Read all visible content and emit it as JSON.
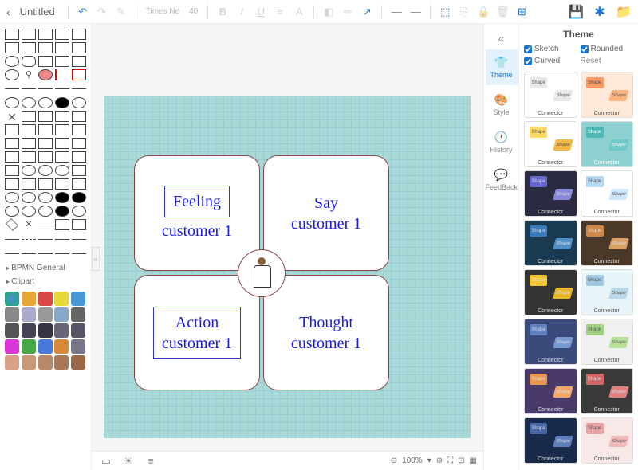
{
  "header": {
    "title": "Untitled",
    "font_name": "Times Ne",
    "font_size": "40"
  },
  "canvas": {
    "q1_line1": "Feeling",
    "q1_line2": "customer 1",
    "q2_line1": "Say",
    "q2_line2": "customer 1",
    "q3_line1": "Action",
    "q3_line2": "customer 1",
    "q4_line1": "Thought",
    "q4_line2": "customer 1"
  },
  "zoom": {
    "level": "100%"
  },
  "sidebar": {
    "cat_bpmn": "BPMN General",
    "cat_clipart": "Clipart"
  },
  "right_tabs": {
    "theme": "Theme",
    "style": "Style",
    "history": "History",
    "feedback": "FeedBack"
  },
  "theme": {
    "title": "Theme",
    "sketch": "Sketch",
    "curved": "Curved",
    "rounded": "Rounded",
    "reset": "Reset",
    "shape_label": "Shape",
    "connector_label": "Connector",
    "swatches": [
      {
        "bg": "#ffffff",
        "s1": "#e8e8e8",
        "s2": "#e8e8e8",
        "fg": "#555"
      },
      {
        "bg": "#ffe8d8",
        "s1": "#ff9966",
        "s2": "#ffb380",
        "fg": "#555"
      },
      {
        "bg": "#ffffff",
        "s1": "#ffd966",
        "s2": "#f4b942",
        "fg": "#555"
      },
      {
        "bg": "#8ecfcf",
        "s1": "#4db8b8",
        "s2": "#6ec9c9",
        "fg": "#fff"
      },
      {
        "bg": "#2a2a40",
        "s1": "#6666cc",
        "s2": "#8888dd",
        "fg": "#ddd"
      },
      {
        "bg": "#ffffff",
        "s1": "#b3d9f2",
        "s2": "#cce6ff",
        "fg": "#555"
      },
      {
        "bg": "#1a3a52",
        "s1": "#3a7ab8",
        "s2": "#5090c8",
        "fg": "#ddd"
      },
      {
        "bg": "#4a3828",
        "s1": "#cc8844",
        "s2": "#d9a066",
        "fg": "#ddd"
      },
      {
        "bg": "#333333",
        "s1": "#f4c430",
        "s2": "#e8b828",
        "fg": "#ddd"
      },
      {
        "bg": "#e8f4f8",
        "s1": "#a0c8e0",
        "s2": "#b8d8e8",
        "fg": "#555"
      },
      {
        "bg": "#3a4a7a",
        "s1": "#6080c0",
        "s2": "#7898d0",
        "fg": "#ddd"
      },
      {
        "bg": "#f0f0f0",
        "s1": "#a0d080",
        "s2": "#b8e098",
        "fg": "#555"
      },
      {
        "bg": "#4a3a6a",
        "s1": "#e89850",
        "s2": "#f0a868",
        "fg": "#ddd"
      },
      {
        "bg": "#3a3a3a",
        "s1": "#d06868",
        "s2": "#e08080",
        "fg": "#ddd"
      },
      {
        "bg": "#1a2a4a",
        "s1": "#4868a8",
        "s2": "#6080c0",
        "fg": "#ddd"
      },
      {
        "bg": "#f8e8e8",
        "s1": "#e8a0a0",
        "s2": "#f0b8b8",
        "fg": "#555"
      }
    ]
  }
}
